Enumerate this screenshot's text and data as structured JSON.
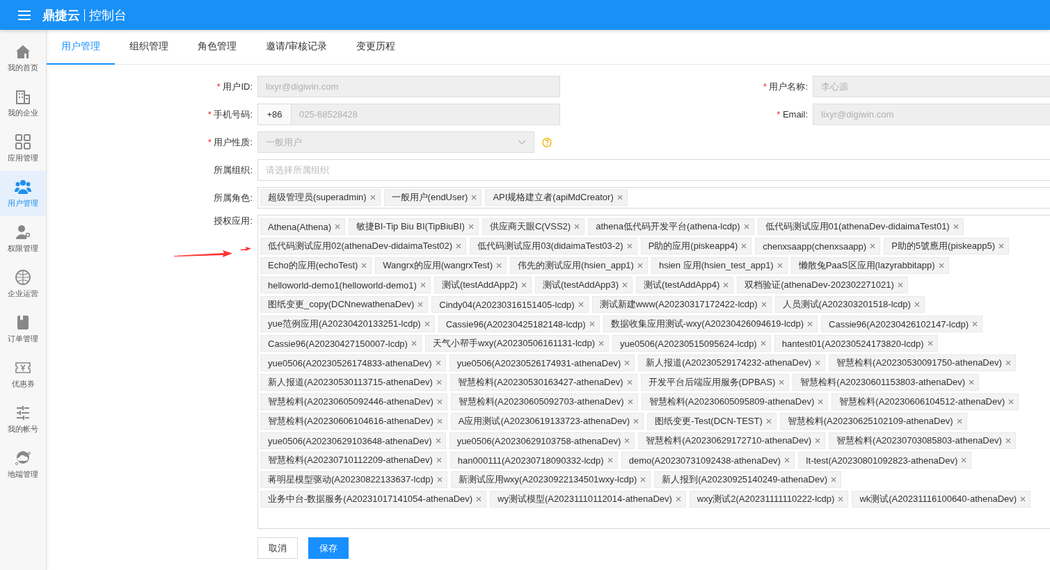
{
  "header": {
    "brand": "鼎捷云",
    "title": "控制台"
  },
  "sidebar": {
    "items": [
      {
        "label": "我的首页",
        "kind": "home",
        "selected": false
      },
      {
        "label": "我的企业",
        "kind": "building",
        "selected": false
      },
      {
        "label": "应用管理",
        "kind": "grid",
        "selected": false
      },
      {
        "label": "用户管理",
        "kind": "users",
        "selected": true
      },
      {
        "label": "权限管理",
        "kind": "userkey",
        "selected": false
      },
      {
        "label": "企业运营",
        "kind": "globe",
        "selected": false
      },
      {
        "label": "订单管理",
        "kind": "book",
        "selected": false
      },
      {
        "label": "优惠券",
        "kind": "coupon",
        "selected": false
      },
      {
        "label": "我的帐号",
        "kind": "sliders",
        "selected": false
      },
      {
        "label": "地端管理",
        "kind": "cloud",
        "selected": false
      }
    ]
  },
  "tabs": [
    {
      "label": "用户管理",
      "selected": true
    },
    {
      "label": "组织管理",
      "selected": false
    },
    {
      "label": "角色管理",
      "selected": false
    },
    {
      "label": "邀请/审核记录",
      "selected": false
    },
    {
      "label": "变更历程",
      "selected": false
    }
  ],
  "form": {
    "required_mark": "*",
    "user_id": {
      "label": "用户ID:",
      "required": true,
      "value": "lixyr@digiwin.com",
      "disabled": true
    },
    "user_name": {
      "label": "用户名称:",
      "required": true,
      "value": "李心源",
      "disabled": true
    },
    "phone": {
      "label": "手机号码:",
      "required": true,
      "country_code": "+86",
      "value": "025-68528428",
      "disabled": true
    },
    "email": {
      "label": "Email:",
      "required": true,
      "value": "lixyr@digiwin.com",
      "disabled": true
    },
    "user_type": {
      "label": "用户性质:",
      "required": true,
      "value": "一般用户",
      "disabled": true
    },
    "organization": {
      "label": "所属组织:",
      "required": false,
      "placeholder": "请选择所属组织",
      "disabled": false
    },
    "roles": {
      "label": "所属角色:",
      "required": false,
      "tags": [
        "超级管理员(superadmin)",
        "一般用户(endUser)",
        "API规格建立者(apiMdCreator)"
      ]
    },
    "apps": {
      "label": "授权应用:",
      "required": false,
      "tags": [
        "Athena(Athena)",
        "敏捷BI-Tip Biu BI(TipBiuBI)",
        "供应商天眼C(VSS2)",
        "athena低代码开发平台(athena-lcdp)",
        "低代码测试应用01(athenaDev-didaimaTest01)",
        "低代码测试应用02(athenaDev-didaimaTest02)",
        "低代码测试应用03(didaimaTest03-2)",
        "P助的应用(piskeapp4)",
        "chenxsaapp(chenxsaapp)",
        "P助的5號應用(piskeapp5)",
        "Echo的应用(echoTest)",
        "Wangrx的应用(wangrxTest)",
        "伟先的测试应用(hsien_app1)",
        "hsien 应用(hsien_test_app1)",
        "懒散兔PaaS区应用(lazyrabbitapp)",
        "helloworld-demo1(helloworld-demo1)",
        "测试(testAddApp2)",
        "测试(testAddApp3)",
        "测试(testAddApp4)",
        "双档验证(athenaDev-202302271021)",
        "图纸变更_copy(DCNnewathenaDev)",
        "Cindy04(A20230316151405-lcdp)",
        "测试新建www(A20230317172422-lcdp)",
        "人员测试(A202303201518-lcdp)",
        "yue范例应用(A20230420133251-lcdp)",
        "Cassie96(A20230425182148-lcdp)",
        "数据收集应用测试-wxy(A20230426094619-lcdp)",
        "Cassie96(A20230426102147-lcdp)",
        "Cassie96(A20230427150007-lcdp)",
        "天气小帮手wxy(A20230506161131-lcdp)",
        "yue0506(A20230515095624-lcdp)",
        "hantest01(A20230524173820-lcdp)",
        "yue0506(A20230526174833-athenaDev)",
        "yue0506(A20230526174931-athenaDev)",
        "新人报道(A20230529174232-athenaDev)",
        "智慧检料(A20230530091750-athenaDev)",
        "新人报道(A20230530113715-athenaDev)",
        "智慧检料(A20230530163427-athenaDev)",
        "开发平台后端应用服务(DPBAS)",
        "智慧检料(A20230601153803-athenaDev)",
        "智慧检料(A20230605092446-athenaDev)",
        "智慧检料(A20230605092703-athenaDev)",
        "智慧检料(A20230605095809-athenaDev)",
        "智慧检料(A20230606104512-athenaDev)",
        "智慧检料(A20230606104616-athenaDev)",
        "A应用测试(A20230619133723-athenaDev)",
        "图纸变更-Test(DCN-TEST)",
        "智慧检料(A20230625102109-athenaDev)",
        "yue0506(A20230629103648-athenaDev)",
        "yue0506(A20230629103758-athenaDev)",
        "智慧检料(A20230629172710-athenaDev)",
        "智慧检料(A20230703085803-athenaDev)",
        "智慧检料(A20230710112209-athenaDev)",
        "han000111(A20230718090332-lcdp)",
        "demo(A20230731092438-athenaDev)",
        "It-test(A20230801092823-athenaDev)",
        "蒋明星模型驱动(A20230822133637-lcdp)",
        "新测试应用wxy(A20230922134501wxy-lcdp)",
        "新人报到(A20230925140249-athenaDev)",
        "业务中台-数据服务(A20231017141054-athenaDev)",
        "wy测试模型(A20231110112014-athenaDev)",
        "wxy测试2(A20231111110222-lcdp)",
        "wk测试(A20231116100640-athenaDev)"
      ]
    }
  },
  "buttons": [
    {
      "label": "取消",
      "kind": "default"
    },
    {
      "label": "保存",
      "kind": "primary"
    }
  ]
}
